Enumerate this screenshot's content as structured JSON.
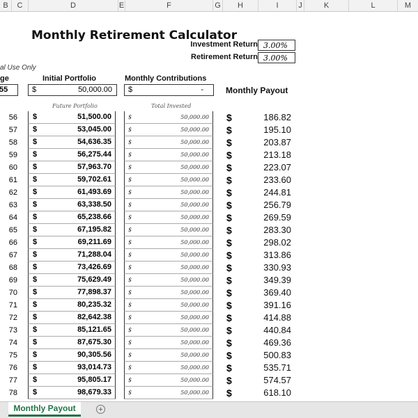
{
  "column_headers": [
    "B",
    "C",
    "D",
    "E",
    "F",
    "G",
    "H",
    "I",
    "J",
    "K",
    "L",
    "M"
  ],
  "sheet": {
    "title": "Monthly Retirement Calculator",
    "investment_return_label": "Investment Return",
    "investment_return_value": "3.00%",
    "retirement_return_label": "Retirement Return",
    "retirement_return_value": "3.00%",
    "note": "al Use Only",
    "age_header": "ge",
    "age_value": "55",
    "initial_portfolio_header": "Initial Portfolio",
    "initial_portfolio_currency": "$",
    "initial_portfolio_value": "50,000.00",
    "monthly_contributions_header": "Monthly Contributions",
    "monthly_contributions_currency": "$",
    "monthly_contributions_value": "-",
    "future_portfolio_label": "Future Portfolio",
    "total_invested_label": "Total Invested",
    "monthly_payout_header": "Monthly Payout",
    "currency": "$",
    "rows": [
      {
        "age": "56",
        "future": "51,500.00",
        "invested": "50,000.00",
        "payout": "186.82"
      },
      {
        "age": "57",
        "future": "53,045.00",
        "invested": "50,000.00",
        "payout": "195.10"
      },
      {
        "age": "58",
        "future": "54,636.35",
        "invested": "50,000.00",
        "payout": "203.87"
      },
      {
        "age": "59",
        "future": "56,275.44",
        "invested": "50,000.00",
        "payout": "213.18"
      },
      {
        "age": "60",
        "future": "57,963.70",
        "invested": "50,000.00",
        "payout": "223.07"
      },
      {
        "age": "61",
        "future": "59,702.61",
        "invested": "50,000.00",
        "payout": "233.60"
      },
      {
        "age": "62",
        "future": "61,493.69",
        "invested": "50,000.00",
        "payout": "244.81"
      },
      {
        "age": "63",
        "future": "63,338.50",
        "invested": "50,000.00",
        "payout": "256.79"
      },
      {
        "age": "64",
        "future": "65,238.66",
        "invested": "50,000.00",
        "payout": "269.59"
      },
      {
        "age": "65",
        "future": "67,195.82",
        "invested": "50,000.00",
        "payout": "283.30"
      },
      {
        "age": "66",
        "future": "69,211.69",
        "invested": "50,000.00",
        "payout": "298.02"
      },
      {
        "age": "67",
        "future": "71,288.04",
        "invested": "50,000.00",
        "payout": "313.86"
      },
      {
        "age": "68",
        "future": "73,426.69",
        "invested": "50,000.00",
        "payout": "330.93"
      },
      {
        "age": "69",
        "future": "75,629.49",
        "invested": "50,000.00",
        "payout": "349.39"
      },
      {
        "age": "70",
        "future": "77,898.37",
        "invested": "50,000.00",
        "payout": "369.40"
      },
      {
        "age": "71",
        "future": "80,235.32",
        "invested": "50,000.00",
        "payout": "391.16"
      },
      {
        "age": "72",
        "future": "82,642.38",
        "invested": "50,000.00",
        "payout": "414.88"
      },
      {
        "age": "73",
        "future": "85,121.65",
        "invested": "50,000.00",
        "payout": "440.84"
      },
      {
        "age": "74",
        "future": "87,675.30",
        "invested": "50,000.00",
        "payout": "469.36"
      },
      {
        "age": "75",
        "future": "90,305.56",
        "invested": "50,000.00",
        "payout": "500.83"
      },
      {
        "age": "76",
        "future": "93,014.73",
        "invested": "50,000.00",
        "payout": "535.71"
      },
      {
        "age": "77",
        "future": "95,805.17",
        "invested": "50,000.00",
        "payout": "574.57"
      },
      {
        "age": "78",
        "future": "98,679.33",
        "invested": "50,000.00",
        "payout": "618.10"
      }
    ]
  },
  "tabs": {
    "active": "Monthly Payout",
    "add_icon": "plus-circle-icon"
  },
  "colors": {
    "accent": "#217346"
  }
}
